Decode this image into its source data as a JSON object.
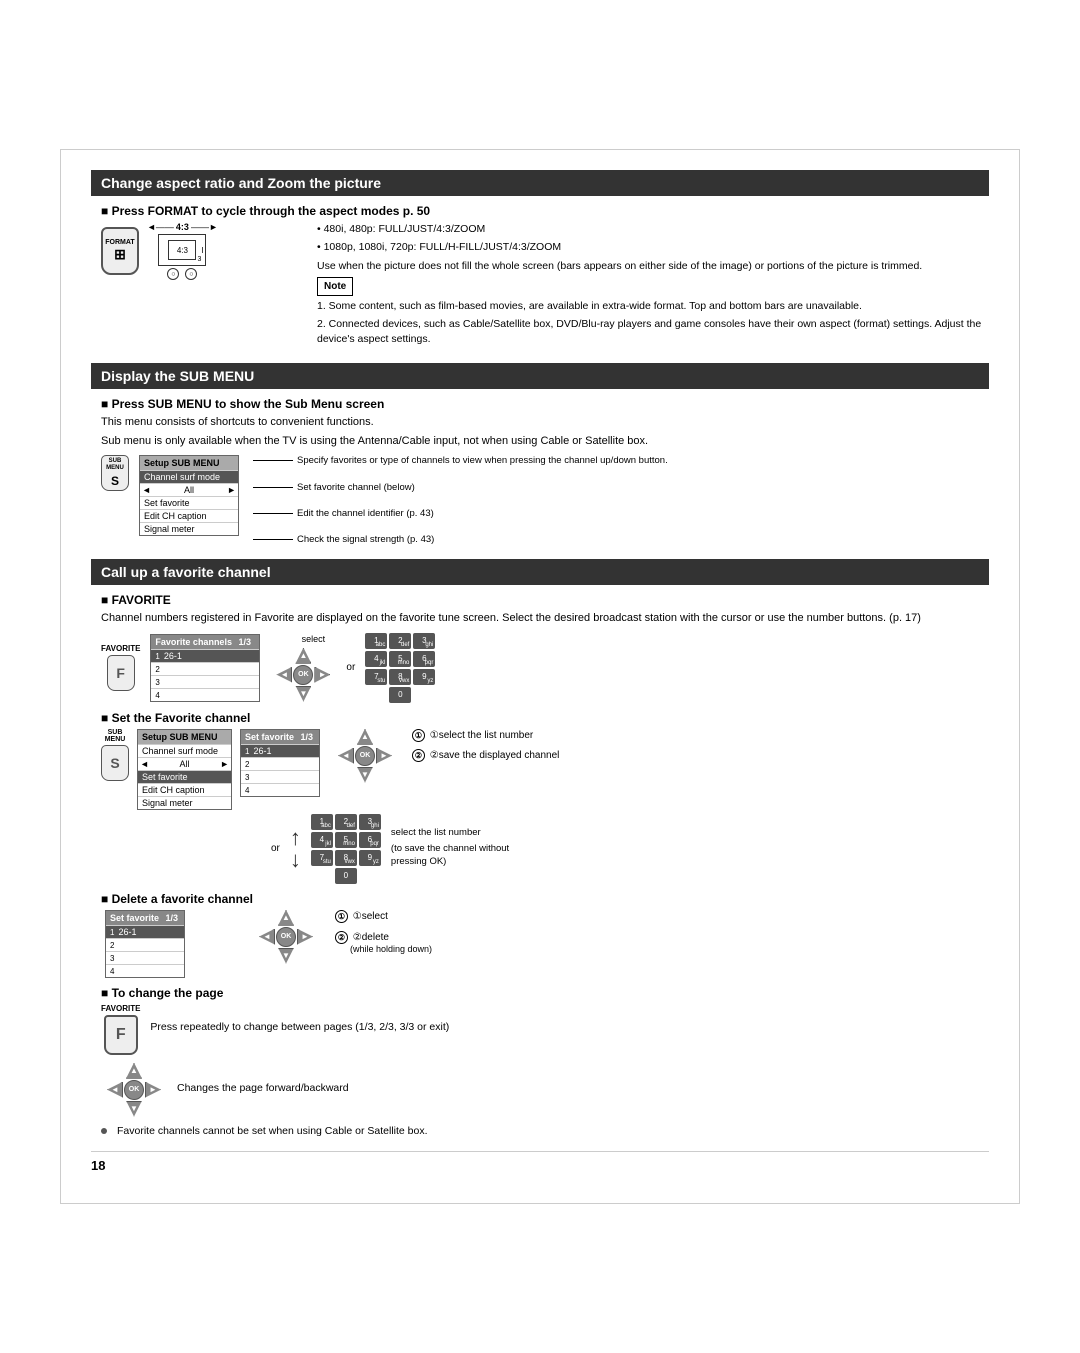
{
  "page": {
    "number": "18",
    "footer_note": "Favorite channels cannot be set when using Cable or Satellite box."
  },
  "section1": {
    "header": "Change aspect ratio and Zoom the picture",
    "subsection1_title": "■ Press FORMAT to cycle through the aspect modes p. 50",
    "format_label": "FORMAT",
    "aspect_label": "4:3",
    "bullet1": "480i, 480p: FULL/JUST/4:3/ZOOM",
    "bullet2": "1080p, 1080i, 720p: FULL/H-FILL/JUST/4:3/ZOOM",
    "use_when": "Use when the picture does not fill the whole screen (bars appears on either side of the image) or portions of the picture is trimmed.",
    "note_label": "Note",
    "note1": "1. Some content, such as film-based movies, are available in extra-wide format. Top and bottom bars are unavailable.",
    "note2": "2. Connected devices, such as Cable/Satellite box, DVD/Blu-ray players and game consoles have their own aspect (format) settings. Adjust the device's aspect settings."
  },
  "section2": {
    "header": "Display the SUB MENU",
    "subsection_title": "■ Press SUB MENU to show the Sub Menu screen",
    "desc1": "This menu consists of shortcuts to convenient functions.",
    "desc2": "Sub menu is only available when the TV is using the Antenna/Cable input, not when using Cable or Satellite box.",
    "menu_header": "Setup SUB MENU",
    "menu_item1": "Channel surf mode",
    "menu_item1_sub": "All",
    "menu_item2": "Set favorite",
    "menu_item3": "Edit CH caption",
    "menu_item4": "Signal meter",
    "ann1": "Specify favorites or type of channels to view when pressing the channel up/down button.",
    "ann2": "Set favorite channel (below)",
    "ann3": "Edit the channel identifier (p. 43)",
    "ann4": "Check the signal strength (p. 43)"
  },
  "section3": {
    "header": "Call up a favorite channel",
    "favorite_label": "FAVORITE",
    "fav_desc": "Channel numbers registered in Favorite are displayed on the favorite tune screen. Select the desired broadcast station with the cursor or use the number buttons. (p. 17)",
    "fav_box_header": "Favorite channels",
    "fav_page": "1/3",
    "fav_item1": "26-1",
    "fav_item2": "",
    "fav_item3": "",
    "fav_item4": "",
    "select_label": "select",
    "or_label": "or",
    "num_buttons": [
      "1",
      "2",
      "3",
      "4",
      "5",
      "6",
      "7",
      "8",
      "9",
      "0"
    ],
    "set_fav_title": "■ Set the Favorite channel",
    "set_fav_menu_header": "Setup SUB MENU",
    "set_fav_menu_item1": "Channel surf mode",
    "set_fav_menu_item2": "All",
    "set_fav_menu_item3": "Set favorite",
    "set_fav_menu_item4": "Edit CH caption",
    "set_fav_menu_item5": "Signal meter",
    "set_fav_box_header": "Set favorite",
    "set_fav_box_page": "1/3",
    "set_fav_item1": "26-1",
    "set_fav_item2": "",
    "set_fav_item3": "",
    "set_fav_item4": "",
    "step1": "①select the list number",
    "step2": "②save the displayed channel",
    "or2": "or",
    "num_label2": "select the list number",
    "no_ok_label": "(to save the channel without pressing OK)",
    "del_fav_title": "■ Delete a favorite channel",
    "del_fav_box_header": "Set favorite",
    "del_fav_box_page": "1/3",
    "del_fav_item1": "26-1",
    "del_step1": "①select",
    "del_step2": "②delete",
    "del_note": "(while holding down)",
    "change_page_title": "■ To change the page",
    "change_page_desc": "Press repeatedly to change between pages (1/3, 2/3, 3/3 or exit)",
    "change_page_desc2": "Changes the page forward/backward"
  }
}
